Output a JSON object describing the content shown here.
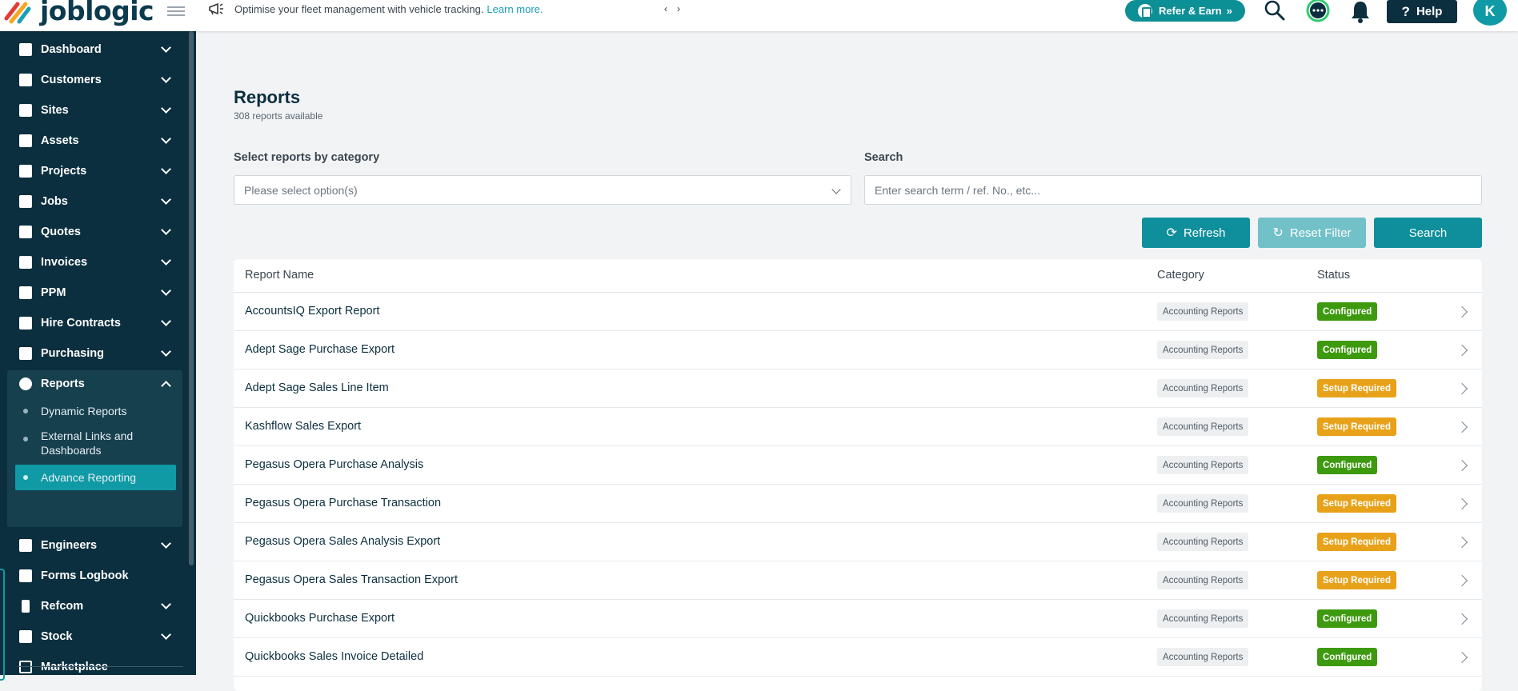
{
  "brand": {
    "name": "joblogic"
  },
  "announcement": {
    "text": "Optimise your fleet management with vehicle tracking.",
    "link": "Learn more."
  },
  "topbar": {
    "refer_label": "Refer & Earn",
    "help_label": "Help",
    "avatar_initial": "K"
  },
  "sidebar": {
    "items": [
      {
        "label": "Dashboard",
        "icon": "dashboard-icon"
      },
      {
        "label": "Customers",
        "icon": "user-icon"
      },
      {
        "label": "Sites",
        "icon": "building-icon"
      },
      {
        "label": "Assets",
        "icon": "asset-icon"
      },
      {
        "label": "Projects",
        "icon": "folder-icon"
      },
      {
        "label": "Jobs",
        "icon": "wrench-icon"
      },
      {
        "label": "Quotes",
        "icon": "clipboard-icon"
      },
      {
        "label": "Invoices",
        "icon": "invoice-icon"
      },
      {
        "label": "PPM",
        "icon": "calendar-icon"
      },
      {
        "label": "Hire Contracts",
        "icon": "contract-icon"
      },
      {
        "label": "Purchasing",
        "icon": "document-icon"
      },
      {
        "label": "Reports",
        "icon": "pie-chart-icon"
      },
      {
        "label": "Engineers",
        "icon": "users-icon"
      },
      {
        "label": "Forms Logbook",
        "icon": "book-icon"
      },
      {
        "label": "Refcom",
        "icon": "cylinder-icon"
      },
      {
        "label": "Stock",
        "icon": "warehouse-icon"
      },
      {
        "label": "Marketplace",
        "icon": "grid-icon"
      }
    ],
    "reports_sub": [
      {
        "label": "Dynamic Reports"
      },
      {
        "label": "External Links and Dashboards"
      },
      {
        "label": "Advance Reporting"
      }
    ]
  },
  "page": {
    "title": "Reports",
    "subtitle": "308 reports available",
    "category_label": "Select reports by category",
    "category_placeholder": "Please select option(s)",
    "search_label": "Search",
    "search_placeholder": "Enter search term / ref. No., etc...",
    "refresh_label": "Refresh",
    "reset_label": "Reset Filter",
    "search_button": "Search"
  },
  "table": {
    "columns": [
      "Report Name",
      "Category",
      "Status"
    ],
    "rows": [
      {
        "name": "AccountsIQ Export Report",
        "category": "Accounting Reports",
        "status": "Configured"
      },
      {
        "name": "Adept Sage Purchase Export",
        "category": "Accounting Reports",
        "status": "Configured"
      },
      {
        "name": "Adept Sage Sales Line Item",
        "category": "Accounting Reports",
        "status": "Setup Required"
      },
      {
        "name": "Kashflow Sales Export",
        "category": "Accounting Reports",
        "status": "Setup Required"
      },
      {
        "name": "Pegasus Opera Purchase Analysis",
        "category": "Accounting Reports",
        "status": "Configured"
      },
      {
        "name": "Pegasus Opera Purchase Transaction",
        "category": "Accounting Reports",
        "status": "Setup Required"
      },
      {
        "name": "Pegasus Opera Sales Analysis Export",
        "category": "Accounting Reports",
        "status": "Setup Required"
      },
      {
        "name": "Pegasus Opera Sales Transaction Export",
        "category": "Accounting Reports",
        "status": "Setup Required"
      },
      {
        "name": "Quickbooks Purchase Export",
        "category": "Accounting Reports",
        "status": "Configured"
      },
      {
        "name": "Quickbooks Sales Invoice Detailed",
        "category": "Accounting Reports",
        "status": "Configured"
      }
    ]
  },
  "colors": {
    "configured": "#3d9a0f",
    "setup_required": "#e8a21a",
    "accent": "#0f9aa6",
    "sidebar": "#0b2f3f"
  }
}
